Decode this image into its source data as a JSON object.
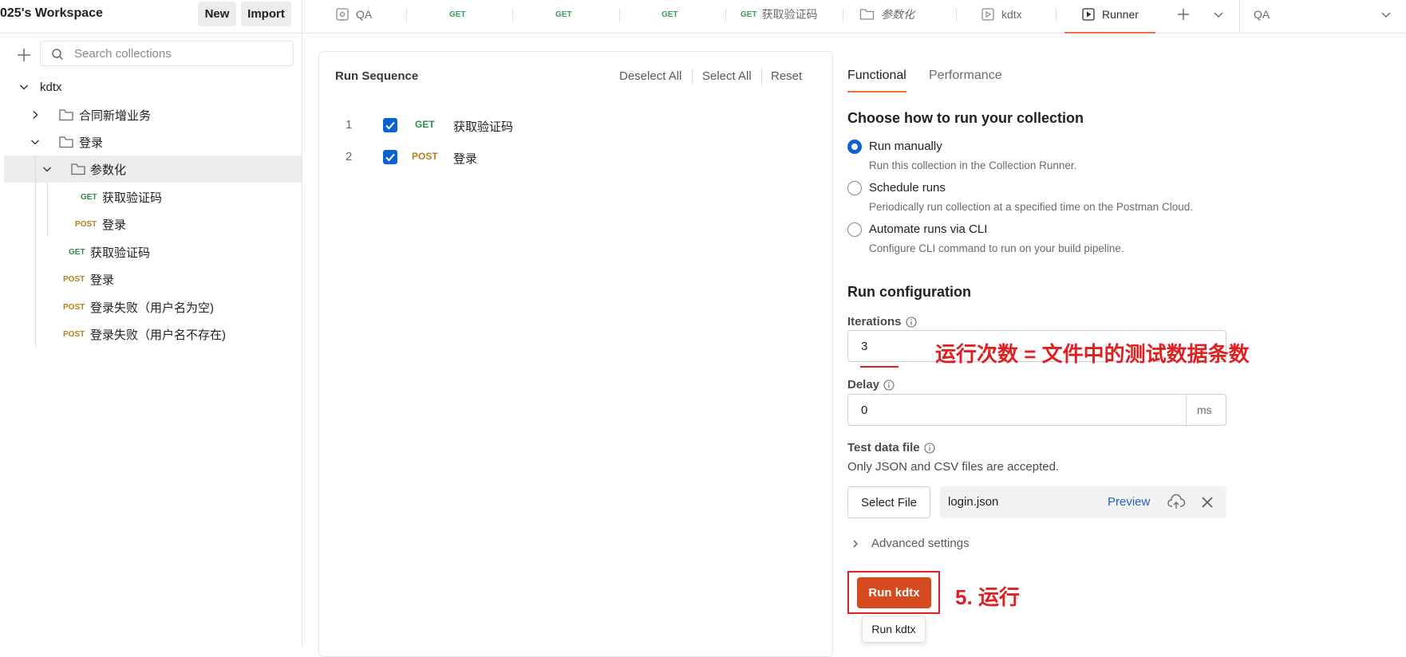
{
  "topbar": {
    "workspace_title": "025's Workspace",
    "new_label": "New",
    "import_label": "Import",
    "tabs": [
      {
        "label": "QA",
        "kind": "env"
      },
      {
        "method": "GET",
        "label": ""
      },
      {
        "method": "GET",
        "label": ""
      },
      {
        "method": "GET",
        "label": ""
      },
      {
        "method": "GET",
        "label": "获取验证码"
      },
      {
        "label": "参数化",
        "kind": "folder"
      },
      {
        "label": "kdtx",
        "kind": "collection"
      },
      {
        "label": "Runner",
        "kind": "runner",
        "active": true
      }
    ],
    "environment_selected": "QA"
  },
  "sidebar": {
    "search_placeholder": "Search collections",
    "tree": {
      "collection": "kdtx",
      "folder1": "合同新增业务",
      "folder2": "登录",
      "folder2_sub": "参数化",
      "sub_req1": {
        "method": "GET",
        "label": "获取验证码"
      },
      "sub_req2": {
        "method": "POST",
        "label": "登录"
      },
      "req3": {
        "method": "GET",
        "label": "获取验证码"
      },
      "req4": {
        "method": "POST",
        "label": "登录"
      },
      "req5": {
        "method": "POST",
        "label": "登录失败（用户名为空)"
      },
      "req6": {
        "method": "POST",
        "label": "登录失败（用户名不存在)"
      }
    }
  },
  "sequence": {
    "title": "Run Sequence",
    "deselect_all": "Deselect All",
    "select_all": "Select All",
    "reset": "Reset",
    "items": [
      {
        "index": "1",
        "method": "GET",
        "label": "获取验证码",
        "checked": true
      },
      {
        "index": "2",
        "method": "POST",
        "label": "登录",
        "checked": true
      }
    ]
  },
  "config": {
    "tabs": {
      "functional": "Functional",
      "performance": "Performance"
    },
    "heading": "Choose how to run your collection",
    "options": [
      {
        "label": "Run manually",
        "desc": "Run this collection in the Collection Runner.",
        "selected": true
      },
      {
        "label": "Schedule runs",
        "desc": "Periodically run collection at a specified time on the Postman Cloud.",
        "selected": false
      },
      {
        "label": "Automate runs via CLI",
        "desc": "Configure CLI command to run on your build pipeline.",
        "selected": false
      }
    ],
    "run_config_heading": "Run configuration",
    "iterations_label": "Iterations",
    "iterations_value": "3",
    "delay_label": "Delay",
    "delay_value": "0",
    "delay_unit": "ms",
    "data_file_label": "Test data file",
    "data_file_note": "Only JSON and CSV files are accepted.",
    "select_file": "Select File",
    "file_name": "login.json",
    "preview": "Preview",
    "advanced": "Advanced settings",
    "run_button": "Run kdtx",
    "run_tooltip": "Run kdtx"
  },
  "annotations": {
    "iterations_note": "运行次数 = 文件中的测试数据条数",
    "run_note": "5. 运行"
  },
  "colors": {
    "accent": "#f26b3a",
    "run_button": "#d64b1e",
    "checkbox": "#0a64d0",
    "get": "#2f8a4d",
    "post": "#b5821b",
    "annotation": "#e02020",
    "link": "#1f62c7"
  }
}
